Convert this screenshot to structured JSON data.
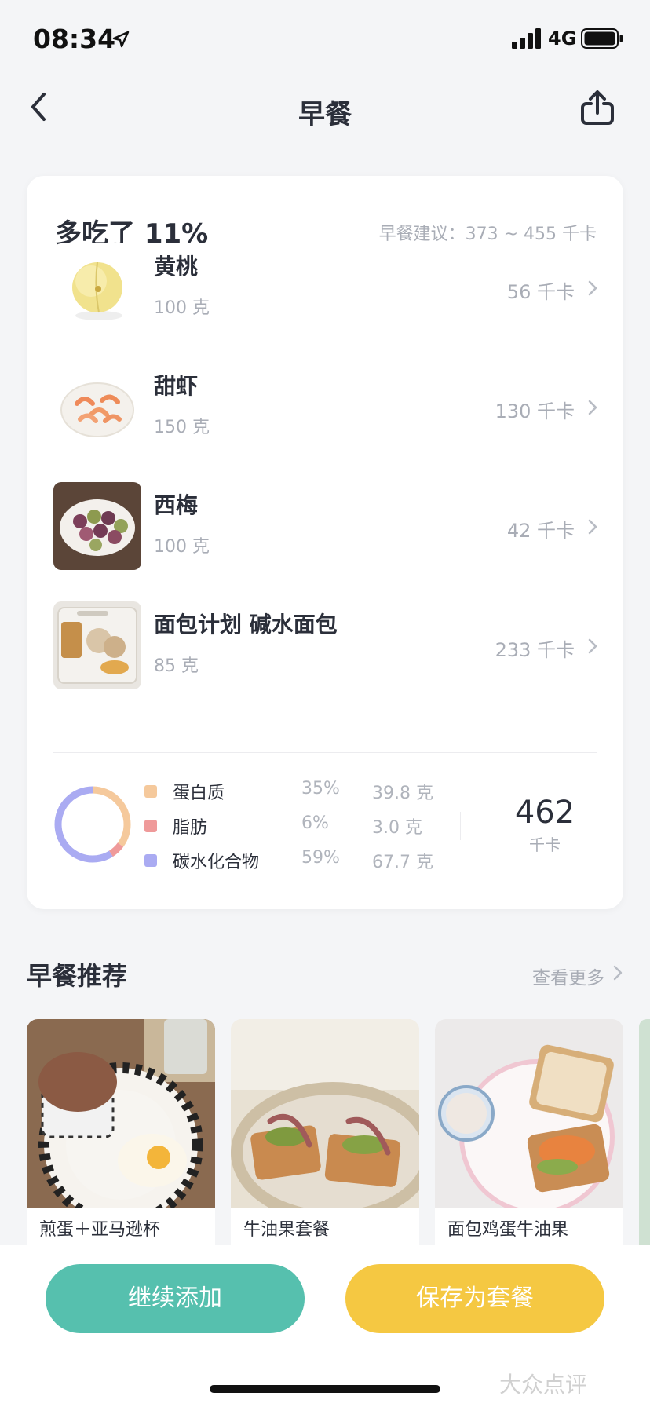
{
  "status_bar": {
    "time": "08:34",
    "network": "4G",
    "icons": [
      "location-arrow-icon",
      "signal-bars-icon",
      "battery-icon"
    ]
  },
  "nav": {
    "title": "早餐",
    "back_icon": "chevron-left-icon",
    "share_icon": "share-upload-icon"
  },
  "summary": {
    "title": "多吃了 11%",
    "advice": "早餐建议：373 ~ 455 千卡"
  },
  "foods": [
    {
      "name": "黄桃",
      "weight": "100 克",
      "kcal": "56 千卡",
      "icon": "yellow-peach-photo"
    },
    {
      "name": "甜虾",
      "weight": "150 克",
      "kcal": "130 千卡",
      "icon": "sweet-shrimp-photo"
    },
    {
      "name": "西梅",
      "weight": "100 克",
      "kcal": "42 千卡",
      "icon": "prune-plate-photo"
    },
    {
      "name": "面包计划 碱水面包",
      "weight": "85 克",
      "kcal": "233 千卡",
      "icon": "pretzel-bread-package-photo"
    }
  ],
  "macros": [
    {
      "name": "蛋白质",
      "pct": "35%",
      "amount": "39.8 克",
      "color": "#f5c99c",
      "share": 0.35
    },
    {
      "name": "脂肪",
      "pct": "6%",
      "amount": "3.0 克",
      "color": "#ef9a9a",
      "share": 0.06
    },
    {
      "name": "碳水化合物",
      "pct": "59%",
      "amount": "67.7 克",
      "color": "#aaabf2",
      "share": 0.59
    }
  ],
  "total": {
    "value": "462",
    "unit": "千卡"
  },
  "recommend": {
    "title": "早餐推荐",
    "more": "查看更多",
    "items": [
      {
        "name": "煎蛋＋亚马逊杯",
        "icon": "fried-egg-muffin-photo"
      },
      {
        "name": "牛油果套餐",
        "icon": "avocado-toast-photo"
      },
      {
        "name": "面包鸡蛋牛油果",
        "icon": "bread-egg-avocado-sandwich-photo"
      }
    ]
  },
  "actions": {
    "continue": "继续添加",
    "save": "保存为套餐"
  },
  "watermark": "大众点评",
  "colors": {
    "accent_teal": "#56c0ae",
    "accent_yellow": "#f5c842",
    "text_primary": "#2b2f3a",
    "text_secondary": "#a9adb6"
  }
}
